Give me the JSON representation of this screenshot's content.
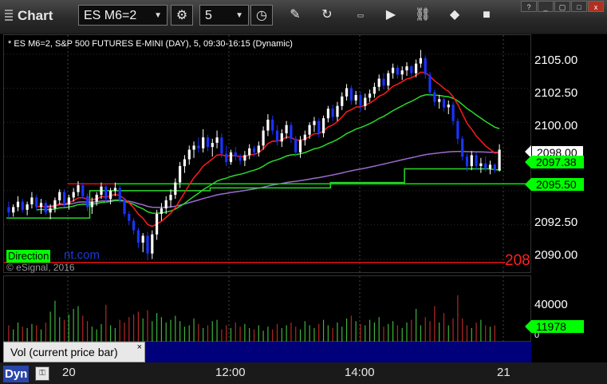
{
  "toolbar": {
    "title": "Chart",
    "symbol": "ES M6=2",
    "interval": "5",
    "icons": [
      "settings-icon",
      "clock-icon",
      "pencil-icon",
      "refresh-icon",
      "get-icon",
      "play-icon",
      "link-icon",
      "camera-icon"
    ]
  },
  "chart": {
    "description": "* ES M6=2, S&P 500 FUTURES E-MINI (DAY), 5, 09:30-16:15 (Dynamic)",
    "direction_label": "Direction",
    "direction_suffix": "nt.com",
    "copyright": "© eSignal, 2016",
    "offscreen_price": "208",
    "price_axis_labels": [
      "2105.00",
      "2102.50",
      "2100.00",
      "2092.50",
      "2090.00"
    ],
    "price_tags": {
      "last": "2098.00",
      "ma": "2097.38",
      "line": "2095.50"
    },
    "volume_axis_labels": [
      "40000",
      "0"
    ],
    "volume_tag": "11978",
    "volume_label": "Vol (current price bar)",
    "volume_close": "×",
    "time_labels": [
      "20",
      "12:00",
      "14:00",
      "21"
    ],
    "dynamic_label": "Dyn",
    "colors": {
      "up": "#ffffff",
      "down": "#1a33ff",
      "ema_red": "#ff1a1a",
      "ema_green": "#2bd92b",
      "purple": "#9b6bcf",
      "level_line": "#00e600",
      "level_red": "#e01010",
      "vol_up": "#3cb43c",
      "vol_down": "#b42828"
    }
  },
  "chart_data": {
    "type": "candlestick",
    "title": "* ES M6=2, S&P 500 FUTURES E-MINI (DAY), 5, 09:30-16:15 (Dynamic)",
    "x_ticks": [
      "20",
      "12:00",
      "14:00",
      "21"
    ],
    "y_ticks": [
      2090.0,
      2092.5,
      2095.0,
      2097.5,
      2100.0,
      2102.5,
      2105.0
    ],
    "ylim": [
      2089.5,
      2105.8
    ],
    "levels": [
      2095.5,
      2089.75
    ],
    "last_price": 2098.0,
    "ma_value": 2097.38,
    "volume_ticks": [
      0,
      40000
    ],
    "volume_last": 11978,
    "ohlc": [
      [
        2093.8,
        2094.2,
        2093.0,
        2093.4
      ],
      [
        2093.4,
        2094.0,
        2093.1,
        2093.8
      ],
      [
        2093.8,
        2094.6,
        2093.5,
        2094.2
      ],
      [
        2094.2,
        2094.4,
        2093.4,
        2093.6
      ],
      [
        2093.6,
        2094.2,
        2093.2,
        2094.0
      ],
      [
        2094.0,
        2094.9,
        2093.7,
        2094.5
      ],
      [
        2094.5,
        2094.7,
        2093.6,
        2093.8
      ],
      [
        2093.8,
        2094.4,
        2093.3,
        2094.1
      ],
      [
        2094.1,
        2094.3,
        2093.2,
        2093.4
      ],
      [
        2093.4,
        2094.0,
        2092.9,
        2093.7
      ],
      [
        2093.7,
        2094.5,
        2093.4,
        2094.3
      ],
      [
        2094.3,
        2095.1,
        2094.0,
        2094.9
      ],
      [
        2094.9,
        2095.1,
        2093.8,
        2094.0
      ],
      [
        2094.0,
        2094.7,
        2093.6,
        2094.5
      ],
      [
        2094.5,
        2095.2,
        2094.2,
        2094.9
      ],
      [
        2094.9,
        2095.7,
        2094.6,
        2095.4
      ],
      [
        2095.4,
        2095.6,
        2094.4,
        2094.6
      ],
      [
        2094.6,
        2094.8,
        2093.5,
        2093.8
      ],
      [
        2093.8,
        2094.5,
        2093.3,
        2094.2
      ],
      [
        2094.2,
        2094.9,
        2093.9,
        2094.7
      ],
      [
        2094.7,
        2095.6,
        2094.4,
        2095.3
      ],
      [
        2095.3,
        2095.5,
        2094.1,
        2094.4
      ],
      [
        2094.4,
        2095.2,
        2094.0,
        2095.0
      ],
      [
        2095.0,
        2095.6,
        2094.6,
        2095.2
      ],
      [
        2095.2,
        2095.4,
        2094.1,
        2094.3
      ],
      [
        2094.3,
        2094.5,
        2093.1,
        2093.3
      ],
      [
        2093.3,
        2093.5,
        2092.5,
        2092.8
      ],
      [
        2092.8,
        2093.0,
        2091.8,
        2092.1
      ],
      [
        2092.1,
        2092.3,
        2090.8,
        2091.2
      ],
      [
        2091.2,
        2091.9,
        2090.5,
        2091.7
      ],
      [
        2091.7,
        2092.0,
        2089.9,
        2090.4
      ],
      [
        2090.4,
        2092.1,
        2090.0,
        2091.8
      ],
      [
        2091.8,
        2093.6,
        2091.4,
        2093.3
      ],
      [
        2093.3,
        2094.1,
        2092.8,
        2093.7
      ],
      [
        2093.7,
        2094.6,
        2093.3,
        2094.3
      ],
      [
        2094.3,
        2095.1,
        2093.8,
        2094.7
      ],
      [
        2094.7,
        2095.9,
        2094.4,
        2095.6
      ],
      [
        2095.6,
        2097.1,
        2095.2,
        2096.8
      ],
      [
        2096.8,
        2097.6,
        2096.3,
        2097.3
      ],
      [
        2097.3,
        2098.3,
        2096.9,
        2098.0
      ],
      [
        2098.0,
        2098.6,
        2097.4,
        2098.3
      ],
      [
        2098.3,
        2098.9,
        2097.8,
        2098.1
      ],
      [
        2098.1,
        2099.5,
        2097.8,
        2098.9
      ],
      [
        2098.9,
        2099.1,
        2097.9,
        2098.2
      ],
      [
        2098.2,
        2098.8,
        2097.5,
        2098.5
      ],
      [
        2098.5,
        2099.4,
        2098.1,
        2098.9
      ],
      [
        2098.9,
        2099.2,
        2097.4,
        2097.7
      ],
      [
        2097.7,
        2098.3,
        2096.8,
        2097.1
      ],
      [
        2097.1,
        2098.0,
        2096.9,
        2097.8
      ],
      [
        2097.8,
        2098.2,
        2097.2,
        2097.5
      ],
      [
        2097.5,
        2097.7,
        2096.9,
        2097.2
      ],
      [
        2097.2,
        2097.9,
        2096.8,
        2097.6
      ],
      [
        2097.6,
        2098.4,
        2097.3,
        2098.1
      ],
      [
        2098.1,
        2098.3,
        2097.5,
        2097.8
      ],
      [
        2097.8,
        2098.6,
        2097.5,
        2098.3
      ],
      [
        2098.3,
        2099.7,
        2098.0,
        2099.4
      ],
      [
        2099.4,
        2100.6,
        2099.0,
        2100.2
      ],
      [
        2100.2,
        2100.5,
        2099.1,
        2099.4
      ],
      [
        2099.4,
        2099.8,
        2098.3,
        2098.6
      ],
      [
        2098.6,
        2099.5,
        2098.2,
        2099.2
      ],
      [
        2099.2,
        2100.1,
        2098.8,
        2099.8
      ],
      [
        2099.8,
        2100.0,
        2098.5,
        2098.8
      ],
      [
        2098.8,
        2099.0,
        2097.5,
        2097.8
      ],
      [
        2097.8,
        2099.0,
        2097.4,
        2098.7
      ],
      [
        2098.7,
        2099.4,
        2098.3,
        2099.1
      ],
      [
        2099.1,
        2100.0,
        2098.8,
        2099.8
      ],
      [
        2099.8,
        2100.4,
        2099.3,
        2100.1
      ],
      [
        2100.1,
        2100.3,
        2098.9,
        2099.2
      ],
      [
        2099.2,
        2100.5,
        2098.9,
        2100.3
      ],
      [
        2100.3,
        2101.2,
        2100.0,
        2101.0
      ],
      [
        2101.0,
        2101.3,
        2100.1,
        2100.4
      ],
      [
        2100.4,
        2101.5,
        2100.1,
        2101.2
      ],
      [
        2101.2,
        2102.2,
        2100.9,
        2101.9
      ],
      [
        2101.9,
        2102.8,
        2101.6,
        2102.5
      ],
      [
        2102.5,
        2102.7,
        2101.3,
        2101.6
      ],
      [
        2101.6,
        2102.3,
        2101.3,
        2102.0
      ],
      [
        2102.0,
        2102.2,
        2100.8,
        2101.2
      ],
      [
        2101.2,
        2102.1,
        2100.9,
        2101.8
      ],
      [
        2101.8,
        2102.4,
        2101.5,
        2102.1
      ],
      [
        2102.1,
        2102.9,
        2101.8,
        2102.6
      ],
      [
        2102.6,
        2103.5,
        2102.3,
        2103.2
      ],
      [
        2103.2,
        2103.6,
        2102.4,
        2102.7
      ],
      [
        2102.7,
        2103.8,
        2102.4,
        2103.6
      ],
      [
        2103.6,
        2104.3,
        2103.2,
        2104.0
      ],
      [
        2104.0,
        2104.2,
        2103.2,
        2103.5
      ],
      [
        2103.5,
        2104.1,
        2103.1,
        2103.8
      ],
      [
        2103.8,
        2104.4,
        2103.4,
        2104.1
      ],
      [
        2104.1,
        2104.2,
        2103.3,
        2103.6
      ],
      [
        2103.6,
        2104.6,
        2103.3,
        2104.3
      ],
      [
        2104.3,
        2105.3,
        2104.0,
        2104.7
      ],
      [
        2104.7,
        2104.9,
        2103.2,
        2103.5
      ],
      [
        2103.5,
        2103.7,
        2101.9,
        2102.2
      ],
      [
        2102.2,
        2102.4,
        2101.2,
        2101.5
      ],
      [
        2101.5,
        2102.0,
        2101.0,
        2101.7
      ],
      [
        2101.7,
        2101.9,
        2100.8,
        2101.1
      ],
      [
        2101.1,
        2101.6,
        2100.6,
        2101.3
      ],
      [
        2101.3,
        2101.5,
        2099.8,
        2100.1
      ],
      [
        2100.1,
        2100.3,
        2098.4,
        2098.8
      ],
      [
        2098.8,
        2099.0,
        2097.2,
        2097.5
      ],
      [
        2097.5,
        2097.7,
        2096.4,
        2096.8
      ],
      [
        2096.8,
        2097.9,
        2096.5,
        2097.6
      ],
      [
        2097.6,
        2097.8,
        2096.5,
        2096.8
      ],
      [
        2096.8,
        2097.4,
        2096.3,
        2097.0
      ],
      [
        2097.0,
        2097.5,
        2096.4,
        2096.6
      ],
      [
        2096.6,
        2097.2,
        2096.2,
        2096.9
      ],
      [
        2096.9,
        2097.0,
        2096.3,
        2096.5
      ],
      [
        2096.5,
        2098.4,
        2096.4,
        2098.0
      ]
    ],
    "volume": [
      12,
      9,
      14,
      11,
      10,
      13,
      12,
      9,
      14,
      22,
      30,
      18,
      16,
      20,
      24,
      26,
      19,
      15,
      11,
      9,
      13,
      27,
      12,
      10,
      16,
      14,
      18,
      20,
      22,
      17,
      23,
      15,
      21,
      18,
      14,
      16,
      19,
      15,
      11,
      12,
      17,
      13,
      10,
      12,
      15,
      16,
      9,
      12,
      10,
      14,
      11,
      13,
      10,
      9,
      12,
      8,
      11,
      9,
      13,
      10,
      12,
      14,
      11,
      9,
      15,
      12,
      10,
      13,
      16,
      12,
      10,
      14,
      11,
      17,
      19,
      15,
      13,
      12,
      16,
      14,
      18,
      11,
      13,
      15,
      12,
      10,
      14,
      16,
      24,
      12,
      18,
      15,
      26,
      14,
      21,
      12,
      17,
      34,
      17,
      12,
      10,
      14,
      16,
      12,
      11,
      12
    ]
  }
}
